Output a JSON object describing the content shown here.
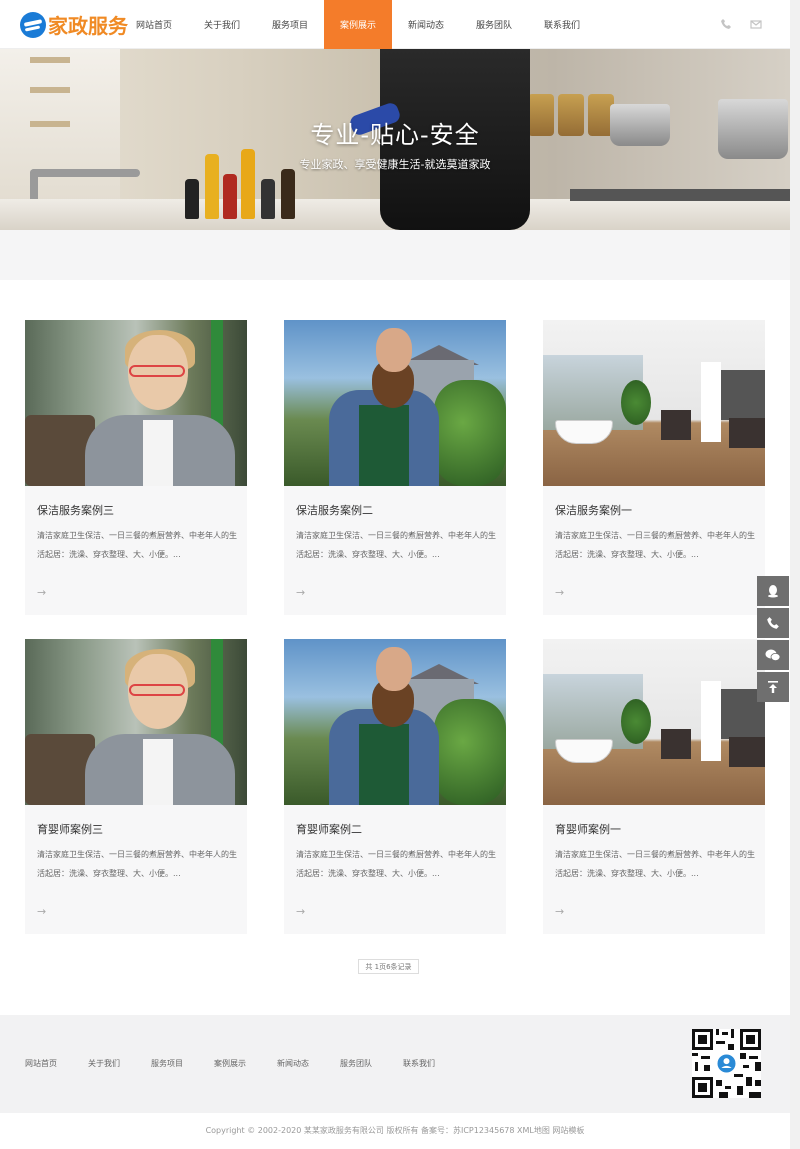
{
  "logo": {
    "text": "家政服务"
  },
  "nav": {
    "items": [
      {
        "label": "网站首页"
      },
      {
        "label": "关于我们"
      },
      {
        "label": "服务项目"
      },
      {
        "label": "案例展示",
        "active": true
      },
      {
        "label": "新闻动态"
      },
      {
        "label": "服务团队"
      },
      {
        "label": "联系我们"
      }
    ]
  },
  "header_icons": [
    "phone-icon",
    "mail-icon"
  ],
  "banner": {
    "title": "专业-贴心-安全",
    "subtitle": "专业家政、享受健康生活-就选莫道家政"
  },
  "cards": [
    {
      "title": "保洁服务案例三",
      "desc": "清洁家庭卫生保洁、一日三餐的煮厨营养、中老年人的生活起居：洗澡、穿衣整理、大、小便。...",
      "image": "woman-phone"
    },
    {
      "title": "保洁服务案例二",
      "desc": "清洁家庭卫生保洁、一日三餐的煮厨营养、中老年人的生活起居：洗澡、穿衣整理、大、小便。...",
      "image": "bearded-gardener"
    },
    {
      "title": "保洁服务案例一",
      "desc": "清洁家庭卫生保洁、一日三餐的煮厨营养、中老年人的生活起居：洗澡、穿衣整理、大、小便。...",
      "image": "bathroom"
    },
    {
      "title": "育婴师案例三",
      "desc": "清洁家庭卫生保洁、一日三餐的煮厨营养、中老年人的生活起居：洗澡、穿衣整理、大、小便。...",
      "image": "woman-phone"
    },
    {
      "title": "育婴师案例二",
      "desc": "清洁家庭卫生保洁、一日三餐的煮厨营养、中老年人的生活起居：洗澡、穿衣整理、大、小便。...",
      "image": "bearded-gardener"
    },
    {
      "title": "育婴师案例一",
      "desc": "清洁家庭卫生保洁、一日三餐的煮厨营养、中老年人的生活起居：洗澡、穿衣整理、大、小便。...",
      "image": "bathroom"
    }
  ],
  "card_arrow": "→",
  "pager": {
    "text": "共 1页6条记录"
  },
  "footer": {
    "links": [
      {
        "label": "网站首页"
      },
      {
        "label": "关于我们"
      },
      {
        "label": "服务项目"
      },
      {
        "label": "案例展示"
      },
      {
        "label": "新闻动态"
      },
      {
        "label": "服务团队"
      },
      {
        "label": "联系我们"
      }
    ],
    "copyright": "Copyright © 2002-2020 某某家政服务有限公司 版权所有 备案号：苏ICP12345678 XML地图 网站模板"
  },
  "side_bar": [
    "qq-icon",
    "phone-icon",
    "wechat-icon",
    "back-to-top-icon"
  ],
  "colors": {
    "accent": "#f47c2a",
    "logo": "#f08a24",
    "logo_mark": "#1a7bd6"
  }
}
